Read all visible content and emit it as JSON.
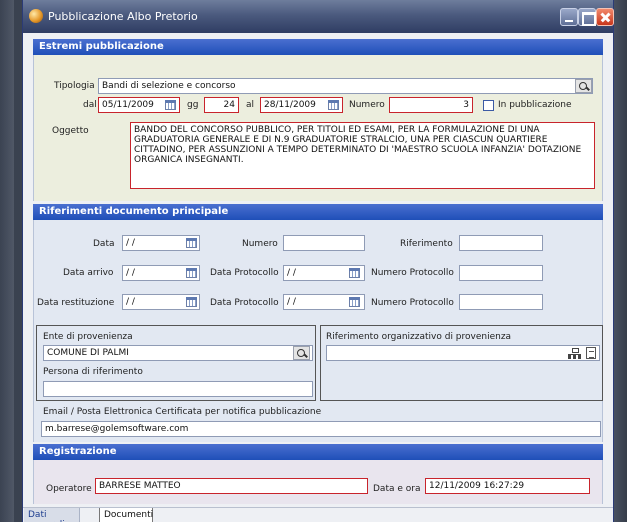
{
  "window": {
    "title": "Pubblicazione Albo Pretorio"
  },
  "sections": {
    "estremi": "Estremi pubblicazione",
    "riferimenti": "Riferimenti documento principale",
    "registrazione": "Registrazione"
  },
  "estremi": {
    "tipologia_label": "Tipologia",
    "tipologia_value": "Bandi di selezione e concorso",
    "dal_label": "dal",
    "dal_value": "05/11/2009",
    "gg_label": "gg",
    "gg_value": "24",
    "al_label": "al",
    "al_value": "28/11/2009",
    "numero_label": "Numero",
    "numero_value": "3",
    "in_pubblicazione_label": "In pubblicazione",
    "in_pubblicazione_checked": false,
    "oggetto_label": "Oggetto",
    "oggetto_value": "BANDO DEL CONCORSO PUBBLICO, PER TITOLI ED ESAMI, PER LA FORMULAZIONE DI UNA GRADUATORIA GENERALE E DI N.9 GRADUATORIE STRALCIO, UNA PER CIASCUN QUARTIERE CITTADINO, PER ASSUNZIONI A TEMPO DETERMINATO DI 'MAESTRO SCUOLA INFANZIA' DOTAZIONE ORGANICA INSEGNANTI."
  },
  "riferimenti": {
    "data_label": "Data",
    "data_value": "/ /",
    "numero_label": "Numero",
    "numero_value": "",
    "riferimento_label": "Riferimento",
    "riferimento_value": "",
    "data_arrivo_label": "Data arrivo",
    "data_arrivo_value": "/ /",
    "data_protocollo_label": "Data Protocollo",
    "data_protocollo_value": "/ /",
    "numero_protocollo_label": "Numero Protocollo",
    "numero_protocollo_value": "",
    "data_restituzione_label": "Data restituzione",
    "data_restituzione_value": "/ /",
    "data_protocollo2_label": "Data Protocollo",
    "data_protocollo2_value": "/ /",
    "numero_protocollo2_label": "Numero Protocollo",
    "numero_protocollo2_value": "",
    "ente_label": "Ente di provenienza",
    "ente_value": "COMUNE DI PALMI",
    "persona_label": "Persona di riferimento",
    "persona_value": "",
    "rif_org_label": "Riferimento organizzativo di provenienza",
    "rif_org_value": "",
    "email_label": "Email / Posta Elettronica Certificata per notifica pubblicazione",
    "email_value": "m.barrese@golemsoftware.com"
  },
  "registrazione": {
    "operatore_label": "Operatore",
    "operatore_value": "BARRESE MATTEO",
    "data_ora_label": "Data e ora",
    "data_ora_value": "12/11/2009 16:27:29"
  },
  "tabs": [
    {
      "label": "Dati generali"
    },
    {
      "label": "Documenti"
    }
  ]
}
